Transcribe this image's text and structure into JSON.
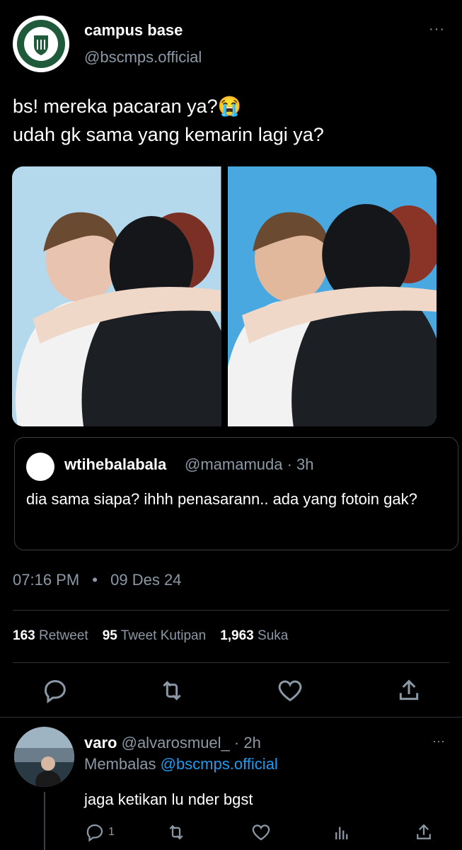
{
  "tweet": {
    "author_name": "campus base",
    "author_handle": "@bscmps.official",
    "text": "bs! mereka pacaran ya?😭\nudah gk sama yang kemarin lagi ya?",
    "time": "07:16 PM",
    "separator": "•",
    "date": "09 Des 24",
    "more": "···"
  },
  "quote": {
    "name": "wtihebalabala",
    "handle_time": "@mamamuda · 3h",
    "text": "dia sama siapa? ihhh penasarann.. ada yang fotoin gak?"
  },
  "stats": {
    "retweet_count": "163",
    "retweet_label": "Retweet",
    "quote_count": "95",
    "quote_label": "Tweet Kutipan",
    "like_count": "1,963",
    "like_label": "Suka"
  },
  "reply": {
    "name": "varo",
    "handle_time": "@alvarosmuel_ · 2h",
    "replying_label": "Membalas",
    "replying_to": "@bscmps.official",
    "text": "jaga ketikan lu nder bgst",
    "reply_count": "1",
    "more": "···"
  },
  "icons": [
    "reply-icon",
    "retweet-icon",
    "like-icon",
    "share-icon",
    "views-icon"
  ],
  "colors": {
    "background": "#000000",
    "muted": "#8b98a5",
    "link": "#1d9bf0",
    "divider": "#2f3336"
  }
}
